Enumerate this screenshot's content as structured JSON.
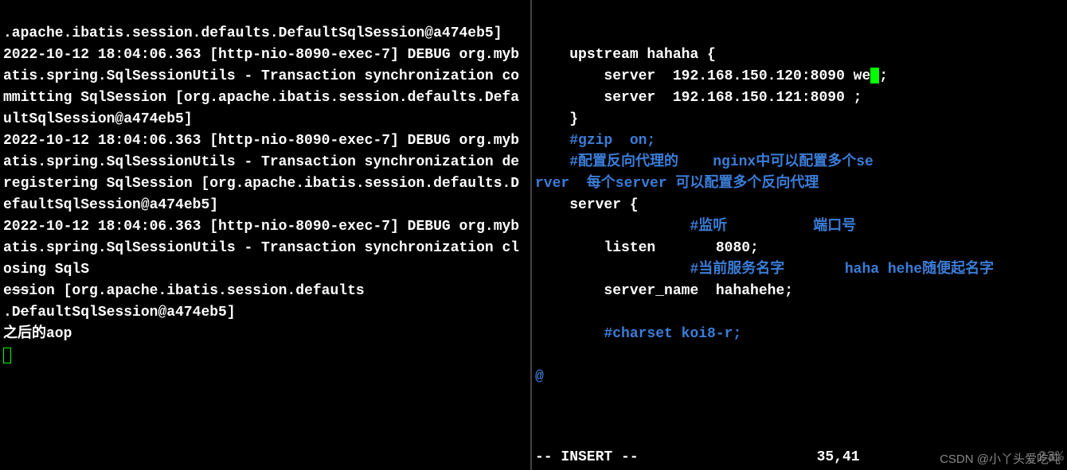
{
  "left": {
    "line1": ".apache.ibatis.session.defaults.DefaultSqlSession@a474eb5]",
    "log1": "2022-10-12 18:04:06.363 [http-nio-8090-exec-7] DEBUG org.mybatis.spring.SqlSessionUtils - Transaction synchronization committing SqlSession [org.apache.ibatis.session.defaults.DefaultSqlSession@a474eb5]",
    "log2": "2022-10-12 18:04:06.363 [http-nio-8090-exec-7] DEBUG org.mybatis.spring.SqlSessionUtils - Transaction synchronization deregistering SqlSession [org.apache.ibatis.session.defaults.DefaultSqlSession@a474eb5]",
    "log3a": "2022-10-12 18:04:06.363 [http-nio-8090-exec-7] DEBUG org.mybatis.spring.SqlSessionUtils - Transaction synchronization closing SqlS",
    "log3b_pre": "e",
    "log3b_strike": "ss",
    "log3b_mid": "ion [org.apache.ibatis.session.defaults",
    "log3c_pre": ".D",
    "log3c_strike": "e",
    "log3c_post": "faultSqlSession@a474eb5]",
    "footer": "之后的aop"
  },
  "right": {
    "upstream_open": "    upstream hahaha {",
    "server1a": "        server  192.168.150.120:8090 we",
    "server1b": ";",
    "server2": "        server  192.168.150.121:8090 ;",
    "close_brace": "    }",
    "gzip": "    #gzip  on;",
    "comment1a": "    #配置反向代理的    nginx中可以配置多个se",
    "comment1b": "rver  每个server 可以配置多个反向代理",
    "server_open": "    server {",
    "comment2a": "                  #监听          端口号",
    "listen": "        listen       8080;",
    "comment3a": "                  #当前服务名字       haha hehe随便起名字",
    "server_name": "        server_name  hahahehe;",
    "charset": "        #charset koi8-r;",
    "at_symbol": "@",
    "mode": "-- INSERT --",
    "position": "35,41",
    "pct": "23%",
    "watermark": "CSDN @小丫头爱吃吨"
  }
}
